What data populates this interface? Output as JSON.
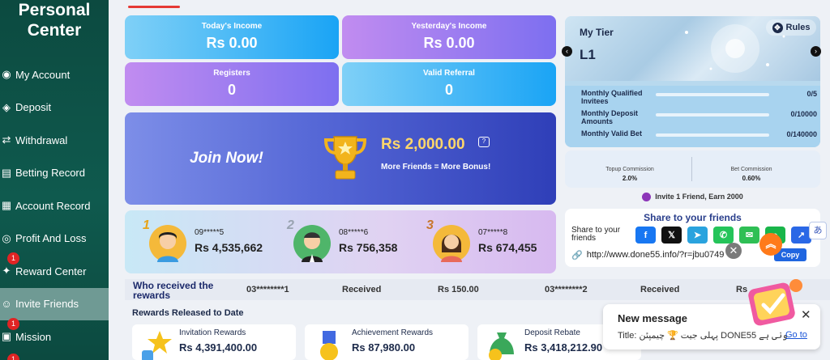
{
  "sidebar": {
    "title_line1": "Personal",
    "title_line2": "Center",
    "items": [
      {
        "label": "My Account",
        "icon": "user-icon",
        "badge": ""
      },
      {
        "label": "Deposit",
        "icon": "deposit-icon",
        "badge": ""
      },
      {
        "label": "Withdrawal",
        "icon": "withdrawal-icon",
        "badge": ""
      },
      {
        "label": "Betting Record",
        "icon": "betting-record-icon",
        "badge": ""
      },
      {
        "label": "Account Record",
        "icon": "account-record-icon",
        "badge": ""
      },
      {
        "label": "Profit And Loss",
        "icon": "profit-loss-icon",
        "badge": ""
      },
      {
        "label": "Reward Center",
        "icon": "reward-icon",
        "badge": "1"
      },
      {
        "label": "Invite Friends",
        "icon": "invite-icon",
        "badge": ""
      },
      {
        "label": "Mission",
        "icon": "gift-icon",
        "badge": "1"
      }
    ],
    "active_index": 7,
    "extra_badge": "1"
  },
  "stats": {
    "today_income_label": "Today's Income",
    "today_income_value": "Rs  0.00",
    "yesterday_income_label": "Yesterday's Income",
    "yesterday_income_value": "Rs  0.00",
    "registers_label": "Registers",
    "registers_value": "0",
    "valid_referral_label": "Valid Referral",
    "valid_referral_value": "0"
  },
  "join": {
    "cta": "Join Now!",
    "amount": "Rs  2,000.00",
    "subtitle": "More Friends = More Bonus!",
    "help_glyph": "?"
  },
  "leaderboard": [
    {
      "rank": "1",
      "name": "09*****5",
      "amount": "Rs  4,535,662"
    },
    {
      "rank": "2",
      "name": "08*****6",
      "amount": "Rs  756,358"
    },
    {
      "rank": "3",
      "name": "07*****8",
      "amount": "Rs  674,455"
    }
  ],
  "tier": {
    "title": "My Tier",
    "level": "L1",
    "rules_label": "Rules",
    "rows": [
      {
        "label": "Monthly Qualified Invitees",
        "value": "0/5",
        "progress": 0
      },
      {
        "label": "Monthly Deposit Amounts",
        "value": "0/10000",
        "progress": 0
      },
      {
        "label": "Monthly Valid Bet",
        "value": "0/140000",
        "progress": 0
      }
    ],
    "topup_label": "Topup Commission",
    "topup_value": "2.0%",
    "bet_label": "Bet Commission",
    "bet_value": "0.60%"
  },
  "invite_banner": "Invite 1 Friend, Earn 2000",
  "share": {
    "title": "Share to your friends",
    "label": "Share to your friends",
    "link": "http://www.done55.info/?r=jbu0749",
    "copy_label": "Copy",
    "buttons": [
      {
        "name": "facebook",
        "glyph": "f",
        "color": "#1877f2"
      },
      {
        "name": "x",
        "glyph": "𝕏",
        "color": "#111111"
      },
      {
        "name": "telegram",
        "glyph": "➤",
        "color": "#2aa3de"
      },
      {
        "name": "whatsapp",
        "glyph": "✆",
        "color": "#25c45a"
      },
      {
        "name": "sms",
        "glyph": "✉",
        "color": "#2fbf55"
      },
      {
        "name": "line",
        "glyph": "●",
        "color": "#19b54a"
      },
      {
        "name": "more",
        "glyph": "↗",
        "color": "#2a68e6"
      }
    ]
  },
  "who_received": {
    "title": "Who received the rewards",
    "entries": [
      {
        "user": "03********1",
        "status": "Received",
        "amount": "Rs  150.00"
      },
      {
        "user": "03********2",
        "status": "Received",
        "amount": "Rs"
      }
    ]
  },
  "rewards": {
    "title": "Rewards Released to Date",
    "cards": [
      {
        "label": "Invitation Rewards",
        "value": "Rs  4,391,400.00"
      },
      {
        "label": "Achievement Rewards",
        "value": "Rs  87,980.00"
      },
      {
        "label": "Deposit Rebate",
        "value": "Rs  3,418,212.90"
      }
    ]
  },
  "popup": {
    "title": "New message",
    "message": "Title: ‏پہلی جیت 🏆 چیمپئن DONE55 ونی ہے",
    "link": "Go to",
    "close_glyph": "✕"
  },
  "colors": {
    "sidebar": "#0f5a4e",
    "income_card": "#1aa9f5",
    "purple_card": "#8e7bf0",
    "join_gold": "#ffd76a",
    "copy": "#2066e0"
  }
}
